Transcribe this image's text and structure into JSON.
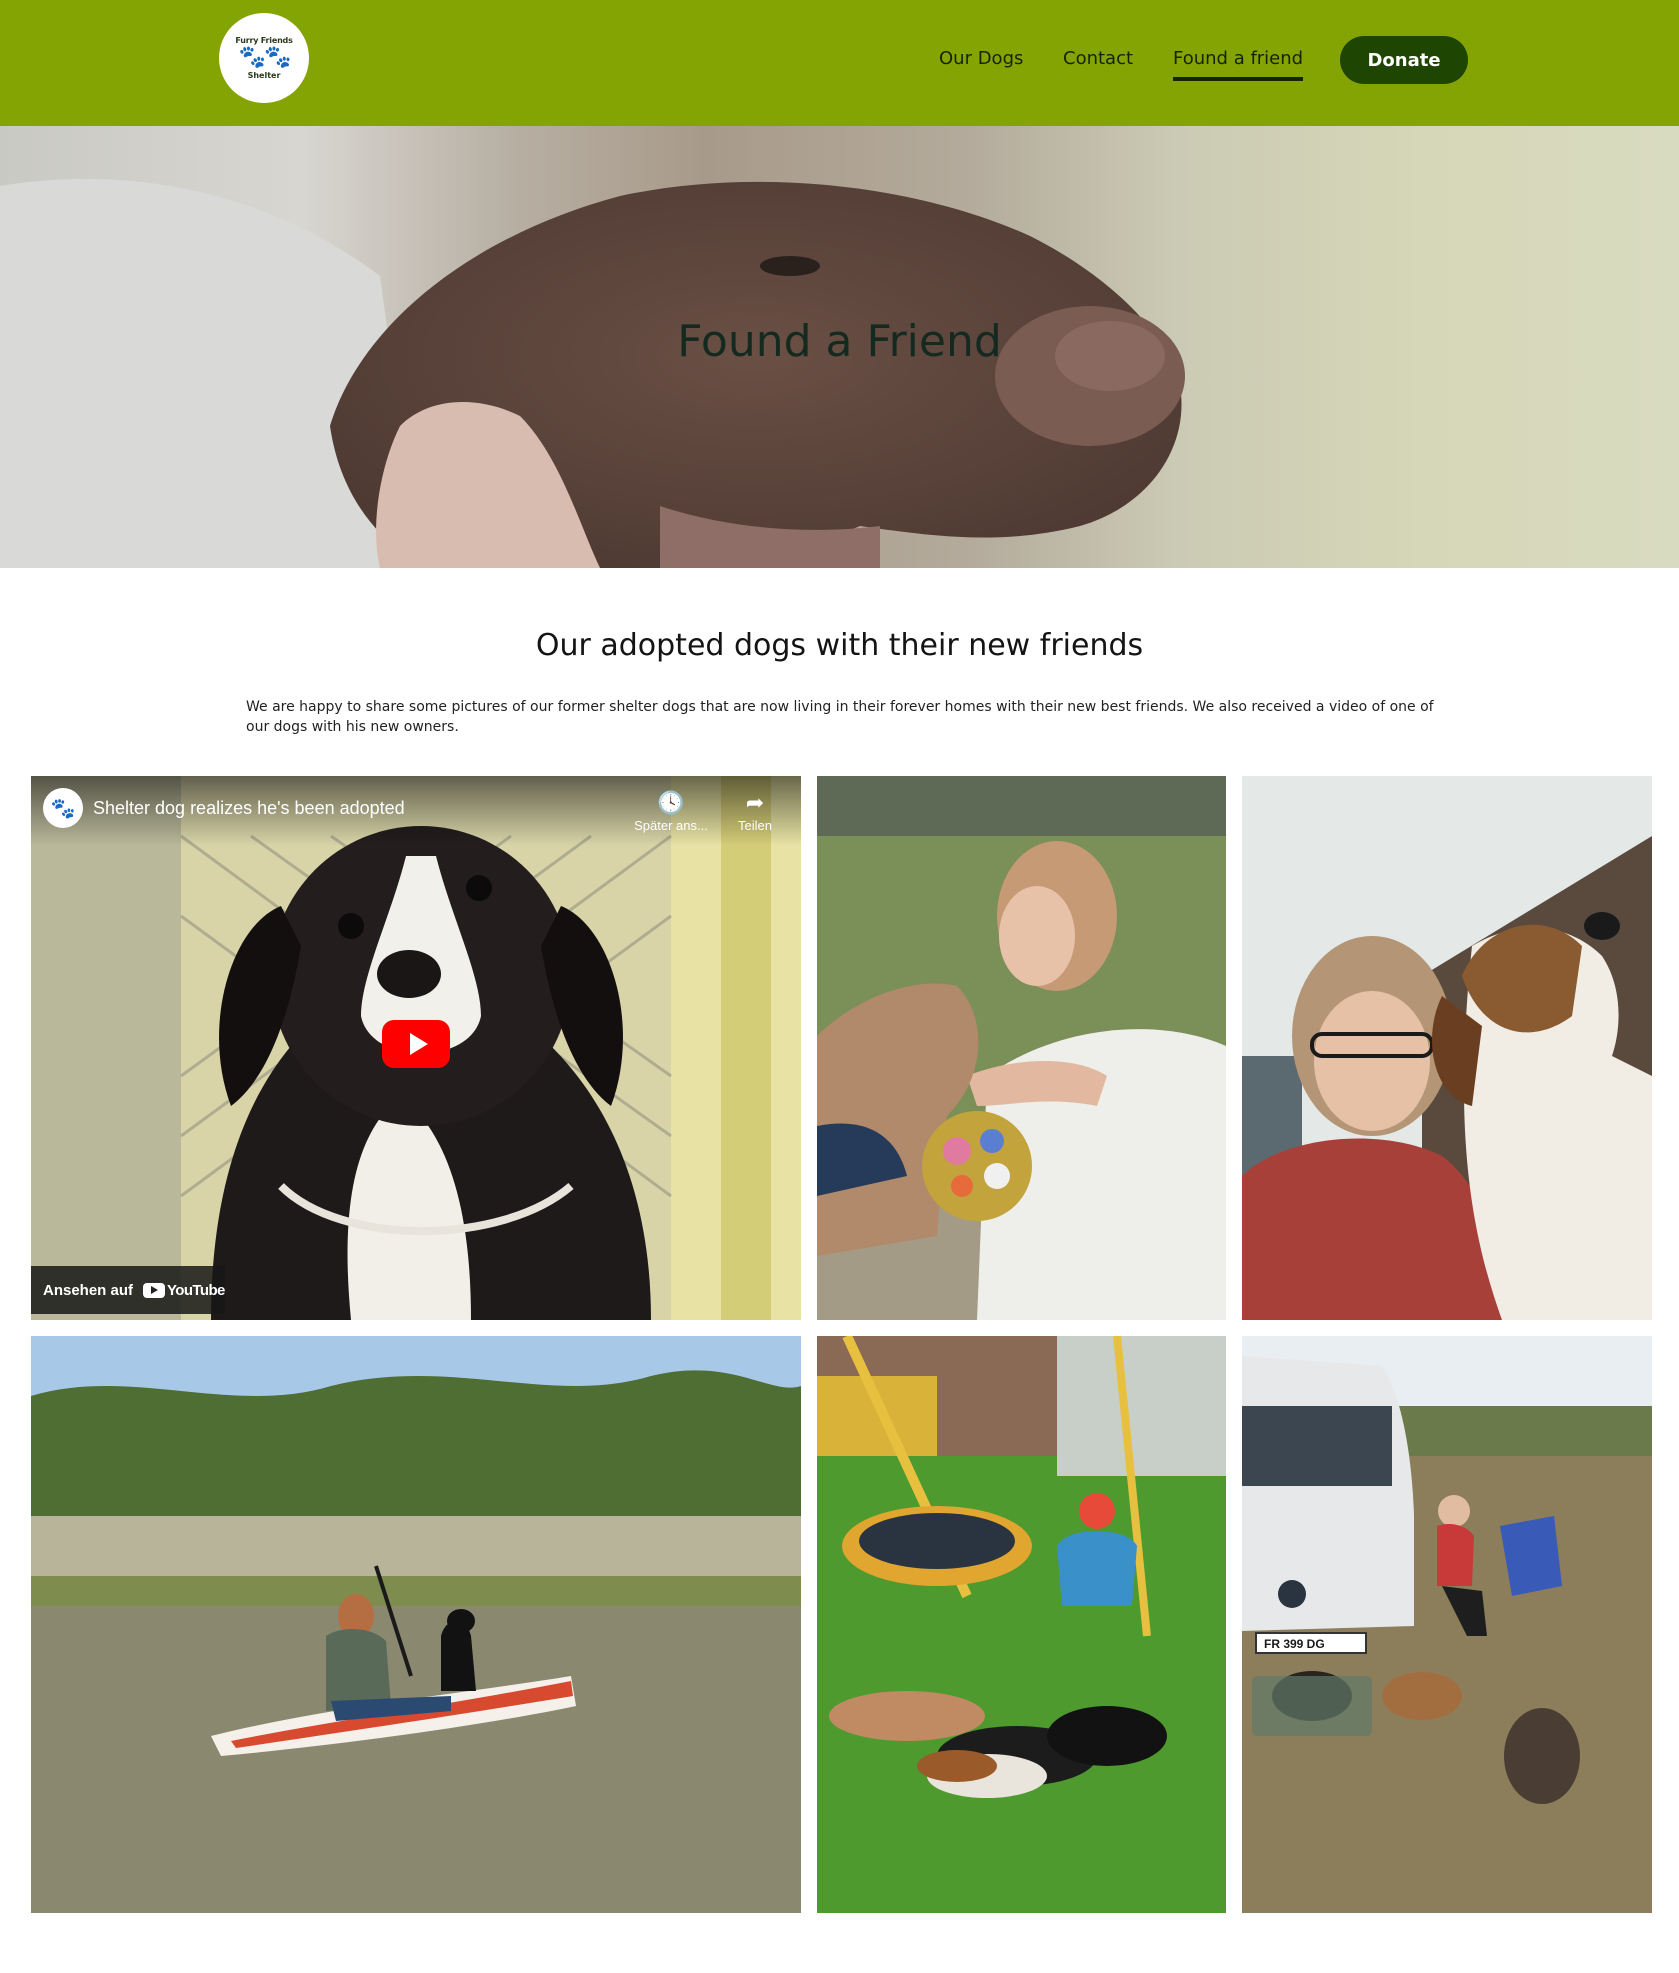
{
  "header": {
    "logo": {
      "top_text": "Furry Friends",
      "bottom_text": "Shelter",
      "icon": "paw-prints-icon"
    },
    "nav": [
      {
        "label": "Our Dogs",
        "active": false
      },
      {
        "label": "Contact",
        "active": false
      },
      {
        "label": "Found a friend",
        "active": true
      }
    ],
    "donate_label": "Donate",
    "colors": {
      "header_bg": "#84a404",
      "donate_bg": "#1e4502",
      "nav_text": "#142400"
    }
  },
  "hero": {
    "title": "Found a Friend"
  },
  "main": {
    "heading": "Our adopted dogs with their new friends",
    "intro": "We are happy to share some pictures of our former shelter dogs that are now living in their forever homes with their new best friends. We also received a video of one of our dogs with his new owners."
  },
  "video": {
    "title": "Shelter dog realizes he's been adopted",
    "watch_later_label": "Später ans...",
    "share_label": "Teilen",
    "watch_on_label": "Ansehen auf",
    "youtube_label": "YouTube",
    "icons": [
      "paw-avatar-icon",
      "clock-icon",
      "share-arrow-icon",
      "play-icon",
      "youtube-logo-icon"
    ]
  },
  "photos": {
    "p4_plate": "FR 399 DG"
  }
}
